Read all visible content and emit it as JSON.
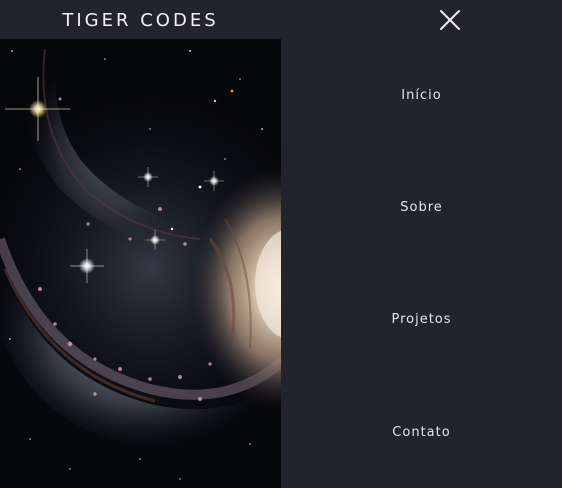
{
  "header": {
    "brand": "TIGER CODES"
  },
  "hero": {
    "image": "spiral-galaxy-image"
  },
  "menu": {
    "close_icon": "close-icon",
    "items": [
      {
        "label": "Início"
      },
      {
        "label": "Sobre"
      },
      {
        "label": "Projetos"
      },
      {
        "label": "Contato"
      }
    ]
  },
  "colors": {
    "background": "#22232d",
    "text": "#e4e4ea",
    "brand_text": "#f2f2f2"
  }
}
